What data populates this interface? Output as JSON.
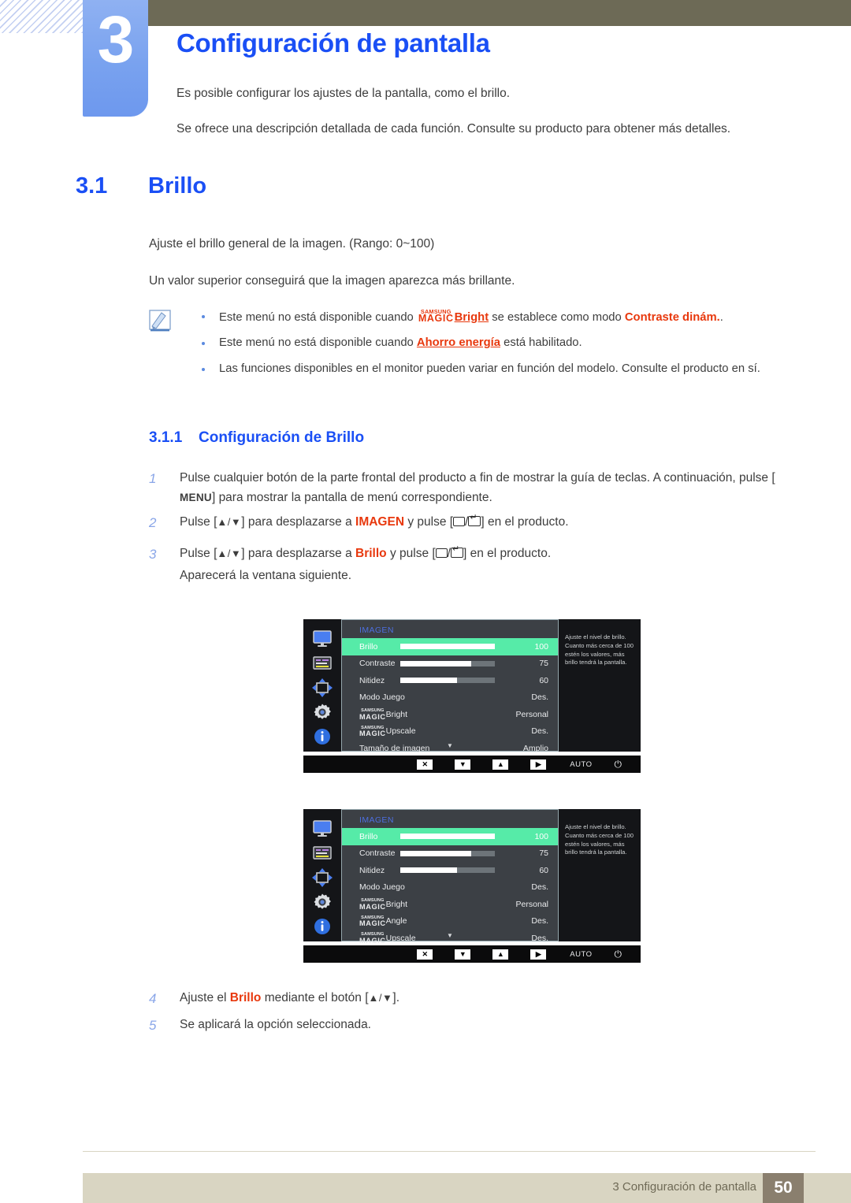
{
  "chapter": {
    "number": "3",
    "title": "Configuración de pantalla",
    "intro_line1": "Es posible configurar los ajustes de la pantalla, como el brillo.",
    "intro_line2": "Se ofrece una descripción detallada de cada función. Consulte su producto para obtener más detalles."
  },
  "section": {
    "number": "3.1",
    "title": "Brillo",
    "paragraph1": "Ajuste el brillo general de la imagen. (Rango: 0~100)",
    "paragraph2": "Un valor superior conseguirá que la imagen aparezca más brillante."
  },
  "note": {
    "icon": "note-pencil-icon",
    "items": [
      {
        "pre": "Este menú no está disponible cuando ",
        "magic_top": "SAMSUNG",
        "magic_bottom": "MAGIC",
        "magic_word": "Bright",
        "mid": " se establece como modo ",
        "highlight": "Contraste dinám.",
        "post": "."
      },
      {
        "pre": "Este menú no está disponible cuando ",
        "highlight_underline": "Ahorro energía",
        "post": " está habilitado."
      },
      {
        "text": "Las funciones disponibles en el monitor pueden variar en función del modelo. Consulte el producto en sí."
      }
    ]
  },
  "subsection": {
    "number": "3.1.1",
    "title": "Configuración de Brillo"
  },
  "steps": [
    {
      "num": "1",
      "pre": "Pulse cualquier botón de la parte frontal del producto a fin de mostrar la guía de teclas. A continuación, pulse [",
      "key": "MENU",
      "post": "] para mostrar la pantalla de menú correspondiente."
    },
    {
      "num": "2",
      "pre": "Pulse [",
      "arrowkeys": "▲/▼",
      "mid": "] para desplazarse a ",
      "highlight": "IMAGEN",
      "mid2": " y pulse [",
      "post": "] en el producto."
    },
    {
      "num": "3",
      "pre": "Pulse [",
      "arrowkeys": "▲/▼",
      "mid": "] para desplazarse a ",
      "highlight": "Brillo",
      "mid2": " y pulse [",
      "post": "] en el producto."
    },
    {
      "num": "",
      "text": "Aparecerá la ventana siguiente."
    },
    {
      "num": "4",
      "pre": "Ajuste el ",
      "highlight": "Brillo",
      "mid": " mediante el botón [",
      "arrowkeys": "▲/▼",
      "post": "]."
    },
    {
      "num": "5",
      "text": "Se aplicará la opción seleccionada."
    }
  ],
  "osd_menus": [
    {
      "title": "IMAGEN",
      "help_text": "Ajuste el nivel de brillo. Cuanto más cerca de 100 estén los valores, más brillo tendrá la pantalla.",
      "rail_icons": [
        "monitor-icon",
        "list-icon",
        "move-arrows-icon",
        "gear-icon",
        "info-icon"
      ],
      "rows": [
        {
          "label": "Brillo",
          "value": "100",
          "bar": 100,
          "selected": true,
          "magic": false
        },
        {
          "label": "Contraste",
          "value": "75",
          "bar": 75,
          "selected": false,
          "magic": false
        },
        {
          "label": "Nitidez",
          "value": "60",
          "bar": 60,
          "selected": false,
          "magic": false
        },
        {
          "label": "Modo Juego",
          "value": "Des.",
          "bar": null,
          "selected": false,
          "magic": false
        },
        {
          "label": "Bright",
          "value": "Personal",
          "bar": null,
          "selected": false,
          "magic": true
        },
        {
          "label": "Upscale",
          "value": "Des.",
          "bar": null,
          "selected": false,
          "magic": true
        },
        {
          "label": "Tamaño de imagen",
          "value": "Amplio",
          "bar": null,
          "selected": false,
          "magic": false
        }
      ],
      "magic_top": "SAMSUNG",
      "magic_bottom": "MAGIC",
      "scroll_down": "▼",
      "buttons": [
        {
          "type": "glyph",
          "label": "✕",
          "name": "close-button"
        },
        {
          "type": "glyph",
          "label": "▼",
          "name": "down-button"
        },
        {
          "type": "glyph",
          "label": "▲",
          "name": "up-button"
        },
        {
          "type": "glyph",
          "label": "▶",
          "name": "enter-button"
        },
        {
          "type": "text",
          "label": "AUTO",
          "name": "auto-button"
        },
        {
          "type": "power",
          "label": "⏻",
          "name": "power-button"
        }
      ]
    },
    {
      "title": "IMAGEN",
      "help_text": "Ajuste el nivel de brillo. Cuanto más cerca de 100 estén los valores, más brillo tendrá la pantalla.",
      "rail_icons": [
        "monitor-icon",
        "list-icon",
        "move-arrows-icon",
        "gear-icon",
        "info-icon"
      ],
      "rows": [
        {
          "label": "Brillo",
          "value": "100",
          "bar": 100,
          "selected": true,
          "magic": false
        },
        {
          "label": "Contraste",
          "value": "75",
          "bar": 75,
          "selected": false,
          "magic": false
        },
        {
          "label": "Nitidez",
          "value": "60",
          "bar": 60,
          "selected": false,
          "magic": false
        },
        {
          "label": "Modo Juego",
          "value": "Des.",
          "bar": null,
          "selected": false,
          "magic": false
        },
        {
          "label": "Bright",
          "value": "Personal",
          "bar": null,
          "selected": false,
          "magic": true
        },
        {
          "label": "Angle",
          "value": "Des.",
          "bar": null,
          "selected": false,
          "magic": true
        },
        {
          "label": "Upscale",
          "value": "Des.",
          "bar": null,
          "selected": false,
          "magic": true
        }
      ],
      "magic_top": "SAMSUNG",
      "magic_bottom": "MAGIC",
      "scroll_down": "▼",
      "buttons": [
        {
          "type": "glyph",
          "label": "✕",
          "name": "close-button"
        },
        {
          "type": "glyph",
          "label": "▼",
          "name": "down-button"
        },
        {
          "type": "glyph",
          "label": "▲",
          "name": "up-button"
        },
        {
          "type": "glyph",
          "label": "▶",
          "name": "enter-button"
        },
        {
          "type": "text",
          "label": "AUTO",
          "name": "auto-button"
        },
        {
          "type": "power",
          "label": "⏻",
          "name": "power-button"
        }
      ]
    }
  ],
  "footer": {
    "text": "3 Configuración de pantalla",
    "page": "50"
  },
  "colors": {
    "heading_blue": "#1a4ff5",
    "tab_blue": "#79a2ef",
    "olive": "#6d6a56",
    "highlight_red": "#e8380d",
    "osd_selected_green": "#56eba8",
    "footer_band": "#d9d5c2",
    "footer_page": "#8a7f6e"
  }
}
